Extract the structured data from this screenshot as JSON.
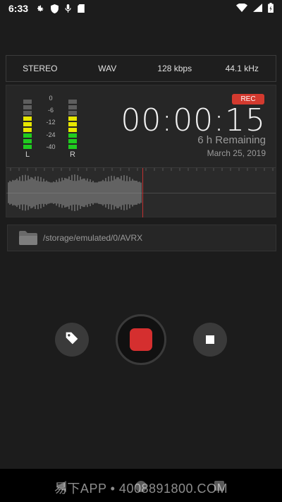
{
  "status": {
    "time": "6:33"
  },
  "format": {
    "channels": "STEREO",
    "container": "WAV",
    "bitrate": "128 kbps",
    "samplerate": "44.1 kHz"
  },
  "meter": {
    "scale": [
      "0",
      "-6",
      "-12",
      "-24",
      "-40"
    ],
    "left_label": "L",
    "right_label": "R"
  },
  "recording": {
    "badge": "REC",
    "timer": "00:00:15",
    "remaining": "6 h Remaining",
    "date": "March 25, 2019"
  },
  "storage": {
    "path": "/storage/emulated/0/AVRX"
  },
  "watermark": {
    "text": "易下APP • 4008891800.COM"
  },
  "colors": {
    "record": "#d52f2f",
    "meter_green": "#1fcc1f",
    "meter_yellow": "#e6e600",
    "background": "#1c1c1c"
  }
}
